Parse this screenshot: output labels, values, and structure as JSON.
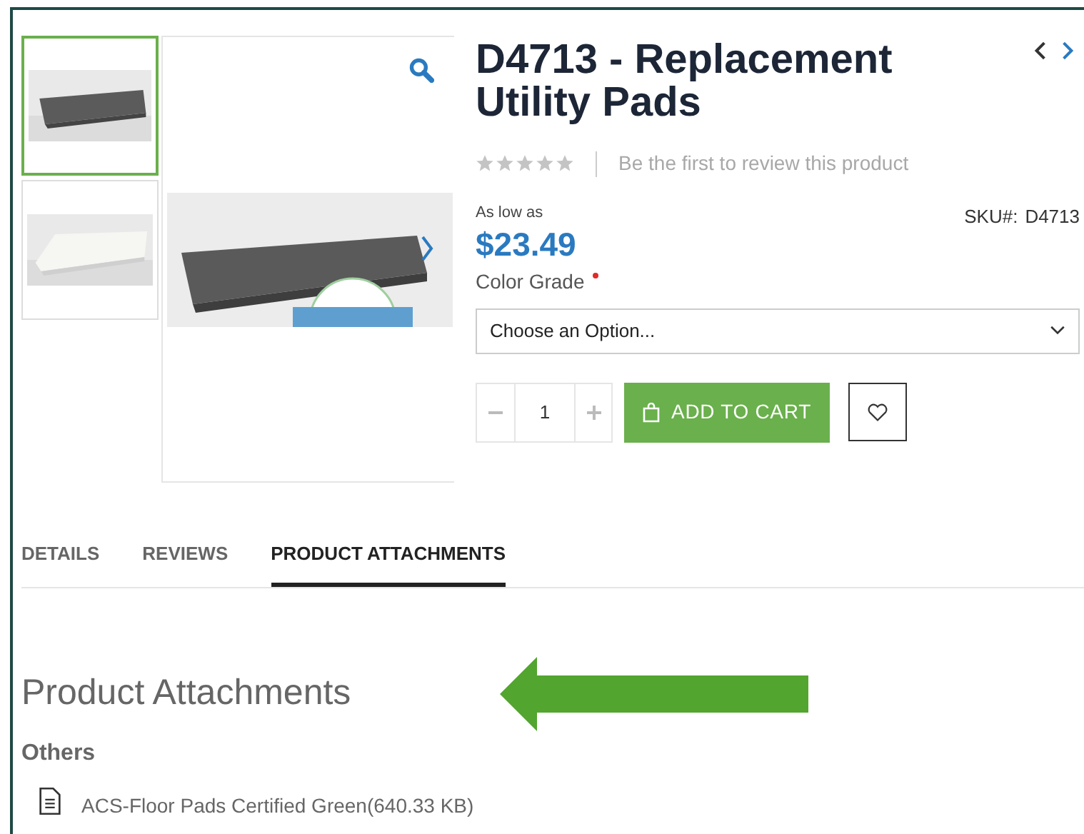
{
  "gallery": {
    "thumbnails": [
      {
        "kind": "picture",
        "selected": true
      },
      {
        "kind": "picture",
        "selected": false
      }
    ]
  },
  "product": {
    "title": "D4713 - Replacement Utility Pads",
    "stars": 0,
    "review_link": "Be the first to review this product",
    "price_label": "As low as",
    "price": "$23.49",
    "sku_label": "SKU#:",
    "sku": "D4713",
    "option": {
      "label": "Color Grade",
      "required": true,
      "placeholder": "Choose an Option..."
    },
    "quantity": "1",
    "add_to_cart": "ADD TO CART"
  },
  "tabs": [
    {
      "label": "DETAILS",
      "selected": false
    },
    {
      "label": "REVIEWS",
      "selected": false
    },
    {
      "label": "PRODUCT ATTACHMENTS",
      "selected": true
    }
  ],
  "attachments": {
    "heading": "Product Attachments",
    "group": "Others",
    "files": [
      "ACS-Floor Pads Certified Green(640.33 KB)"
    ]
  }
}
